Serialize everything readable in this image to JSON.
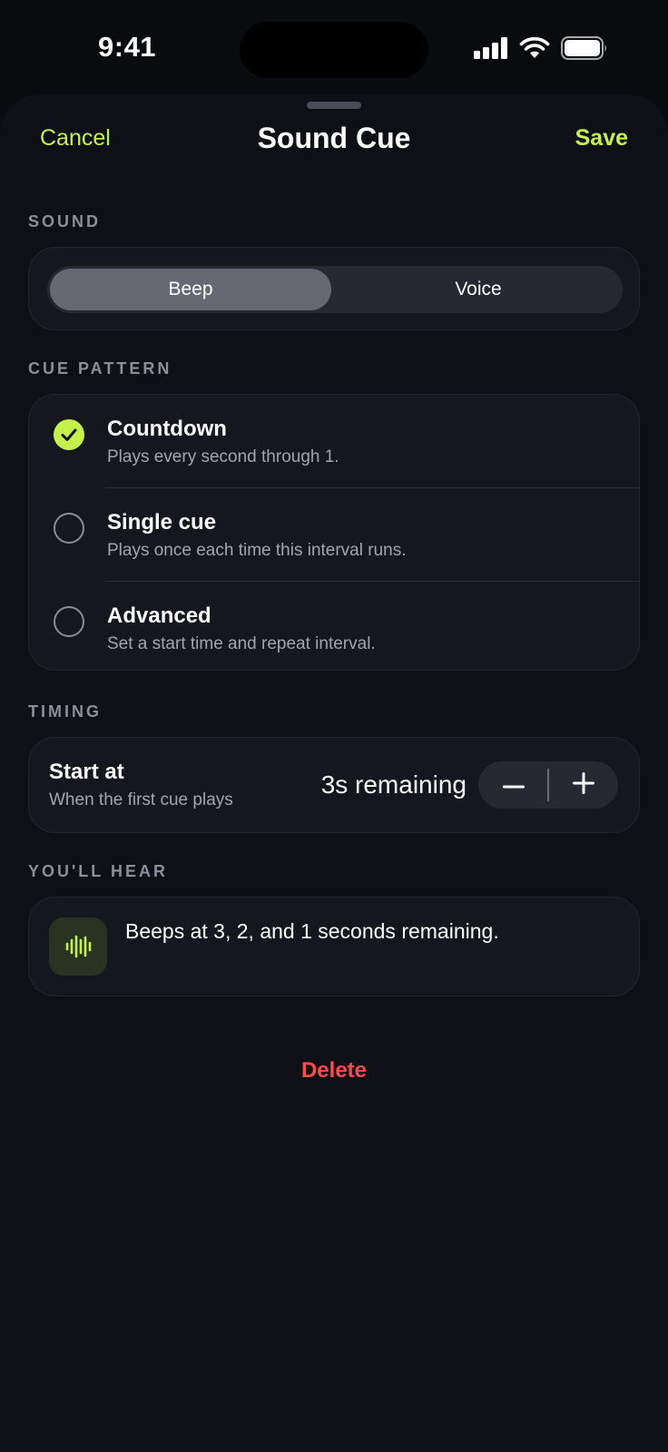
{
  "status_bar": {
    "time": "9:41"
  },
  "nav": {
    "cancel_label": "Cancel",
    "title": "Sound Cue",
    "save_label": "Save"
  },
  "sound": {
    "section_label": "SOUND",
    "options": [
      "Beep",
      "Voice"
    ],
    "selected": "Beep"
  },
  "pattern": {
    "section_label": "CUE PATTERN",
    "items": [
      {
        "title": "Countdown",
        "subtitle": "Plays every second through 1.",
        "checked": true
      },
      {
        "title": "Single cue",
        "subtitle": "Plays once each time this interval runs.",
        "checked": false
      },
      {
        "title": "Advanced",
        "subtitle": "Set a start time and repeat interval.",
        "checked": false
      }
    ]
  },
  "timing": {
    "section_label": "TIMING",
    "title": "Start at",
    "subtitle": "When the first cue plays",
    "value": "3s remaining"
  },
  "preview": {
    "section_label": "YOU'LL HEAR",
    "text": "Beeps at 3, 2, and 1 seconds remaining."
  },
  "delete_label": "Delete",
  "colors": {
    "accent": "#c4f24a",
    "destructive": "#ff4a4a",
    "background": "#0a0b0f",
    "card": "#15171f"
  }
}
